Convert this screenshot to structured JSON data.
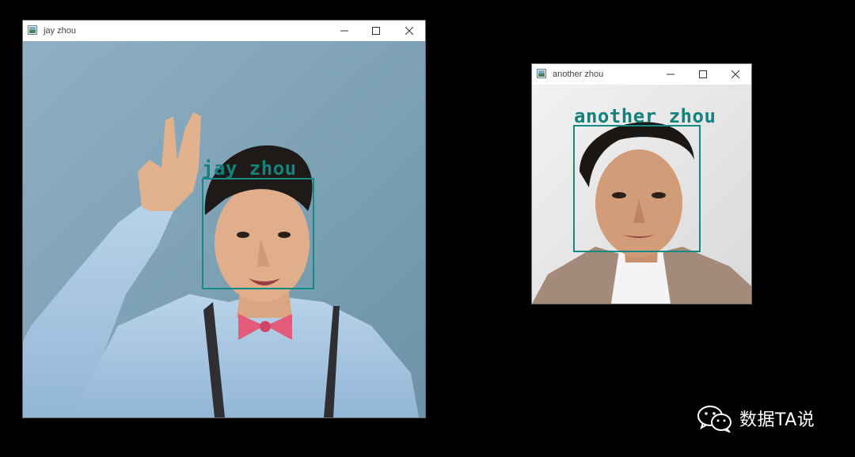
{
  "windows": [
    {
      "title": "jay zhou",
      "face_label": "jay zhou"
    },
    {
      "title": "another zhou",
      "face_label": "another zhou"
    }
  ],
  "colors": {
    "box": "#138a82",
    "label": "#14817b",
    "desktop": "#000000"
  },
  "watermark": {
    "text": "数据TA说",
    "icon": "wechat-icon"
  }
}
